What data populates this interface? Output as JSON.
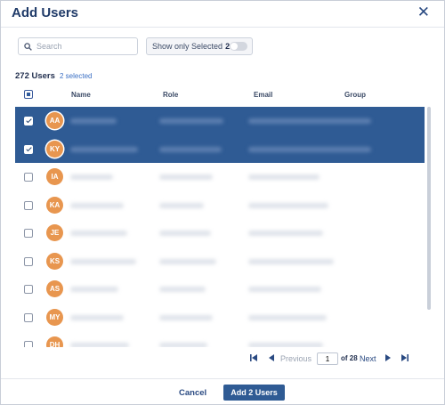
{
  "dialog": {
    "title": "Add Users",
    "close_symbol": "✕"
  },
  "search": {
    "placeholder": "Search",
    "value": ""
  },
  "filter": {
    "label": "Show only Selected",
    "count": "2",
    "toggle_on": false
  },
  "summary": {
    "users_count": "272 Users",
    "selected_count": "2 selected"
  },
  "columns": {
    "name": "Name",
    "role": "Role",
    "email": "Email",
    "group": "Group"
  },
  "rows": [
    {
      "initials": "AA",
      "selected": true
    },
    {
      "initials": "KY",
      "selected": true
    },
    {
      "initials": "IA",
      "selected": false
    },
    {
      "initials": "KA",
      "selected": false
    },
    {
      "initials": "JE",
      "selected": false
    },
    {
      "initials": "KS",
      "selected": false
    },
    {
      "initials": "AS",
      "selected": false
    },
    {
      "initials": "MY",
      "selected": false
    },
    {
      "initials": "DH",
      "selected": false
    }
  ],
  "pagination": {
    "previous_label": "Previous",
    "current_page": "1",
    "of_label": "of 28",
    "next_label": "Next"
  },
  "footer": {
    "cancel_label": "Cancel",
    "add_label": "Add 2 Users"
  },
  "colors": {
    "accent": "#2f5b94",
    "avatar": "#e8964f",
    "title": "#1f3a68"
  },
  "icons": [
    "close-icon",
    "search-icon",
    "first-page-icon",
    "previous-page-icon",
    "next-page-icon",
    "last-page-icon"
  ]
}
